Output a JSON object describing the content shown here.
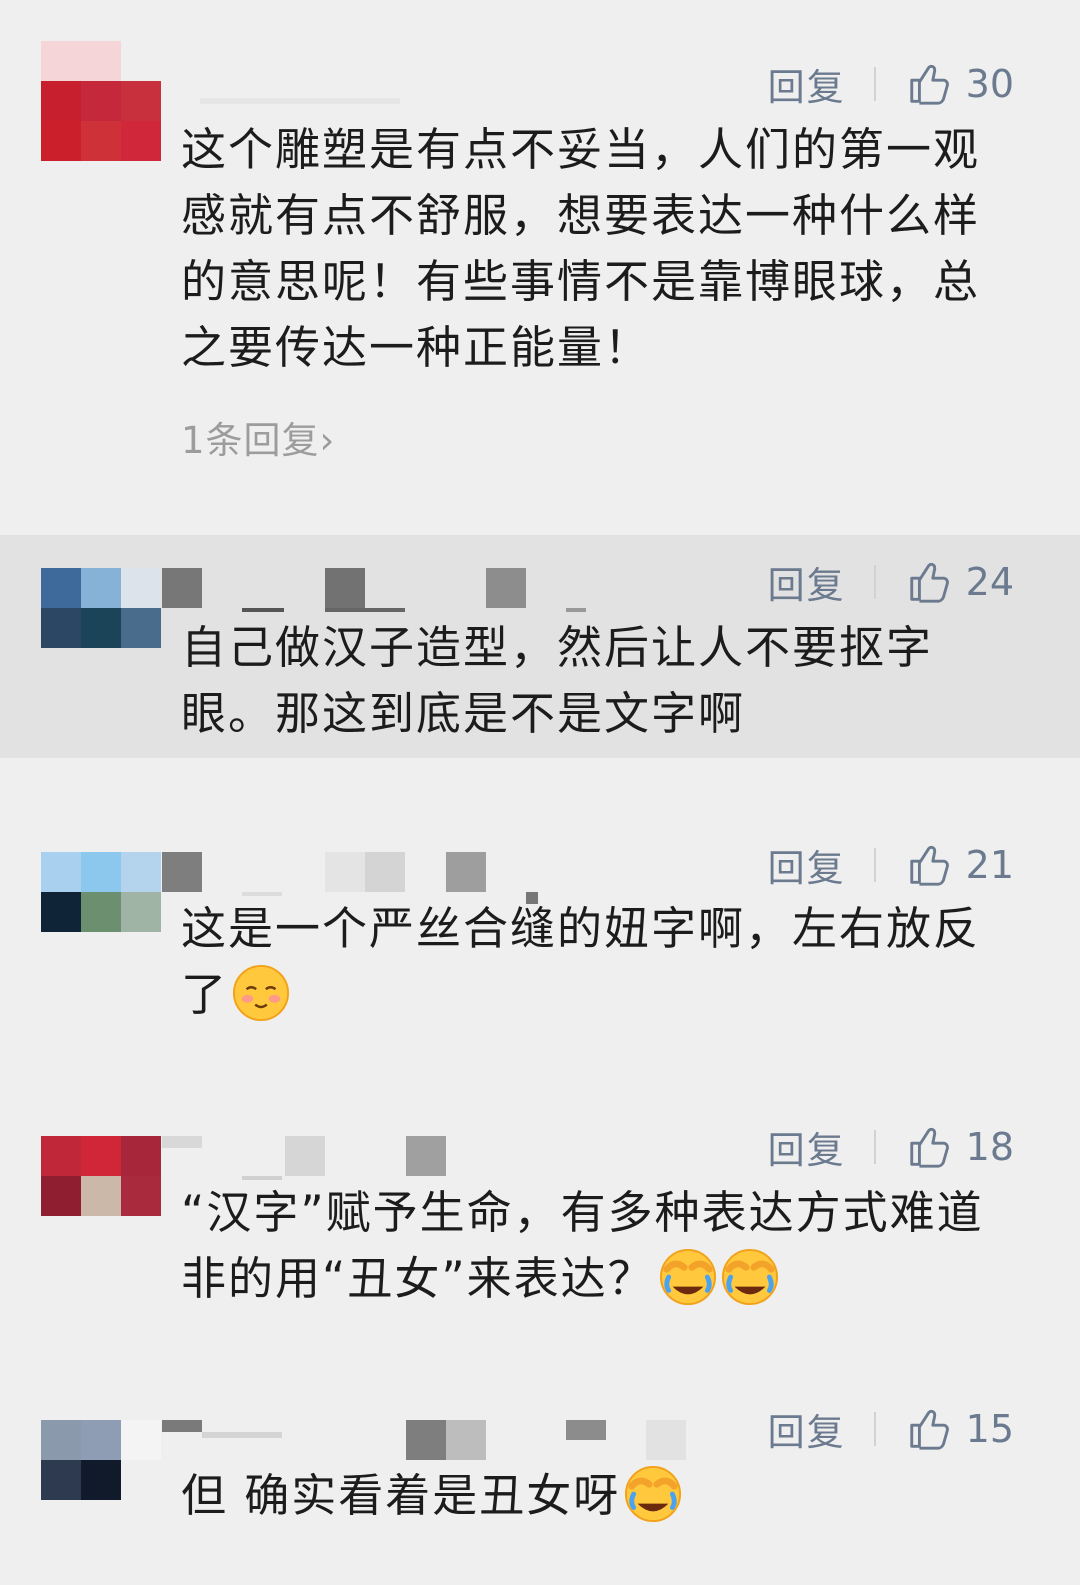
{
  "comments": [
    {
      "reply_label": "回复",
      "likes": "30",
      "lines": [
        "这个雕塑是有点不妥当，人们的第一观",
        "感就有点不舒服，想要表达一种什么样",
        "的意思呢！有些事情不是靠博眼球，总",
        "之要传达一种正能量！"
      ],
      "more_replies": "1条回复",
      "more_replies_chevron": "›"
    },
    {
      "reply_label": "回复",
      "likes": "24",
      "lines": [
        "自己做汉子造型，然后让人不要抠字",
        "眼。那这到底是不是文字啊"
      ]
    },
    {
      "reply_label": "回复",
      "likes": "21",
      "lines": [
        "这是一个严丝合缝的妞字啊，左右放反",
        "了"
      ],
      "emojis": [
        "blush-emoji"
      ]
    },
    {
      "reply_label": "回复",
      "likes": "18",
      "lines": [
        "“汉字”赋予生命，有多种表达方式难道",
        "非的用“丑女”来表达？"
      ],
      "emojis": [
        "laugh-cry-emoji",
        "laugh-cry-emoji"
      ]
    },
    {
      "reply_label": "回复",
      "likes": "15",
      "lines": [
        "但 确实看着是丑女呀"
      ],
      "emojis": [
        "laugh-cry-emoji"
      ]
    }
  ],
  "colors": {
    "background": "#efefef",
    "highlight_row": "#e2e2e2",
    "action_text": "#6b7a8e",
    "body_text": "#1c1c1c",
    "muted_text": "#9c9c9c"
  },
  "icons": {
    "like": "thumbs-up-icon"
  }
}
